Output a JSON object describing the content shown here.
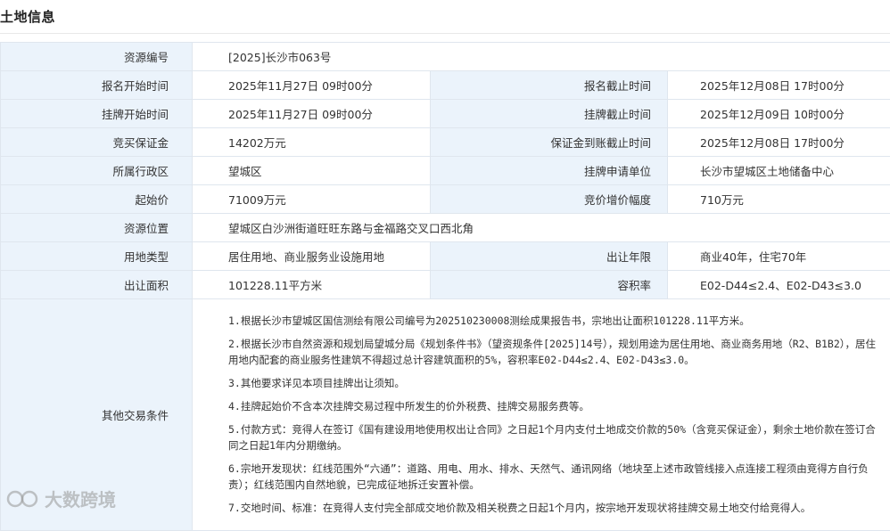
{
  "page_title": "土地信息",
  "rows": {
    "r1": {
      "label": "资源编号",
      "value": "[2025]长沙市063号"
    },
    "r2": {
      "label": "报名开始时间",
      "value": "2025年11月27日 09时00分",
      "label2": "报名截止时间",
      "value2": "2025年12月08日 17时00分"
    },
    "r3": {
      "label": "挂牌开始时间",
      "value": "2025年11月27日 09时00分",
      "label2": "挂牌截止时间",
      "value2": "2025年12月09日 10时00分"
    },
    "r4": {
      "label": "竞买保证金",
      "value": "14202万元",
      "label2": "保证金到账截止时间",
      "value2": "2025年12月08日 17时00分"
    },
    "r5": {
      "label": "所属行政区",
      "value": "望城区",
      "label2": "挂牌申请单位",
      "value2": "长沙市望城区土地储备中心"
    },
    "r6": {
      "label": "起始价",
      "value": "71009万元",
      "label2": "竞价增价幅度",
      "value2": "710万元"
    },
    "r7": {
      "label": "资源位置",
      "value": "望城区白沙洲街道旺旺东路与金福路交叉口西北角"
    },
    "r8": {
      "label": "用地类型",
      "value": "居住用地、商业服务业设施用地",
      "label2": "出让年限",
      "value2": "商业40年，住宅70年"
    },
    "r9": {
      "label": "出让面积",
      "value": "101228.11平方米",
      "label2": "容积率",
      "value2": "E02-D44≤2.4、E02-D43≤3.0"
    }
  },
  "other_conditions": {
    "label": "其他交易条件",
    "items": [
      "1.根据长沙市望城区国信测绘有限公司编号为202510230008测绘成果报告书，宗地出让面积101228.11平方米。",
      "2.根据长沙市自然资源和规划局望城分局《规划条件书》（望资规条件[2025]14号），规划用途为居住用地、商业商务用地（R2、B1B2），居住用地内配套的商业服务性建筑不得超过总计容建筑面积的5%，容积率E02-D44≤2.4、E02-D43≤3.0。",
      "3.其他要求详见本项目挂牌出让须知。",
      "4.挂牌起始价不含本次挂牌交易过程中所发生的价外税费、挂牌交易服务费等。",
      "5.付款方式：竞得人在签订《国有建设用地使用权出让合同》之日起1个月内支付土地成交价款的50%（含竞买保证金），剩余土地价款在签订合同之日起1年内分期缴纳。",
      "6.宗地开发现状：红线范围外“六通”：道路、用电、用水、排水、天然气、通讯网络（地块至上述市政管线接入点连接工程须由竞得方自行负责）；红线范围内自然地貌，已完成征地拆迁安置补偿。",
      "7.交地时间、标准：在竞得人支付完全部成交地价款及相关税费之日起1个月内，按宗地开发现状将挂牌交易土地交付给竞得人。"
    ]
  },
  "watermark": {
    "text": "大数跨境",
    "icon": "logo-icon"
  }
}
